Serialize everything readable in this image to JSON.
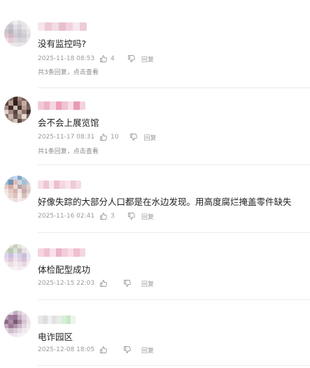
{
  "comments": [
    {
      "text": "没有监控吗?",
      "date": "2025-11-18 08:53",
      "likes": "4",
      "reply_label": "回复",
      "replies_text": "共3条回复，点击查看",
      "avatar_colors": [
        "#e9e7ec",
        "#dcd8de",
        "#f1eef1",
        "#e4e0e6",
        "#e9e6ea",
        "#f3f1f4",
        "#d3d0d7",
        "#c7c2cc",
        "#e2dfe4",
        "#d7d3da",
        "#e7e4e9",
        "#f0edf0",
        "#c9c5ce",
        "#bbb5c1",
        "#d7d3da",
        "#cbc7d0",
        "#d8d4db",
        "#e9e6ea",
        "#e0c4cf",
        "#d5b6c2",
        "#cfcad4",
        "#c7c2cc",
        "#d0ccd5",
        "#e2dfe4",
        "#f0dde4",
        "#e8c8d4",
        "#dcd8de",
        "#d6d2d9",
        "#d9d5dc",
        "#eceaee",
        "#f4eef1",
        "#efe3e8",
        "#ebe8ec",
        "#e8e5ea",
        "#ebe8ec",
        "#f2f0f3"
      ],
      "name_colors": [
        "#f4e6ec",
        "#eccad7",
        "#f2dde5",
        "#e8bfcf",
        "#f0d3de",
        "#f6e8ee",
        "#eecbd8"
      ]
    },
    {
      "text": "会不会上展览馆",
      "date": "2025-11-17 08:31",
      "likes": "10",
      "reply_label": "回复",
      "replies_text": "共1条回复，点击查看",
      "avatar_colors": [
        "#6d5a57",
        "#8c6f66",
        "#3d2b2a",
        "#a48478",
        "#7a5f57",
        "#9b857a",
        "#5c4641",
        "#b79b8b",
        "#2c1e1e",
        "#8e6b60",
        "#c7ae9f",
        "#6c5450",
        "#a78d81",
        "#3e2c2a",
        "#d2bcb0",
        "#4a3633",
        "#b89b8e",
        "#7d625b",
        "#e0cfc6",
        "#a3887c",
        "#5a4541",
        "#c4aea2",
        "#8c7268",
        "#3c2c2a",
        "#917469",
        "#cdb6aa",
        "#6b534d",
        "#a28a7e",
        "#e6d8d0",
        "#7b6058",
        "#4f3c39",
        "#b19a8f",
        "#d5c3ba",
        "#5f4843",
        "#9f857a",
        "#c9b4a9"
      ],
      "name_colors": [
        "#f2c9d8",
        "#eab4c8",
        "#f6d7e2",
        "#ee9fbb",
        "#f0c2d2",
        "#f7dfe8",
        "#e99ab7",
        "#f3d2de"
      ]
    },
    {
      "text": "好像失踪的大部分人口都是在水边发现。用高度腐烂掩盖零件缺失",
      "date": "2025-11-16 02:41",
      "likes": "3",
      "reply_label": "回复",
      "replies_text": "",
      "avatar_colors": [
        "#8fb6d6",
        "#a7c7e1",
        "#c6d9ea",
        "#7ea7cb",
        "#b6cfe4",
        "#d7e5f0",
        "#9ab9d5",
        "#6f93b6",
        "#e2b9b3",
        "#cfd6de",
        "#a4bfd9",
        "#c0cbd6",
        "#e4ccc7",
        "#d9a7a0",
        "#f0dad6",
        "#b7a4a8",
        "#cfb7b6",
        "#e6d4d1",
        "#f1e4e2",
        "#e9c7c1",
        "#d4b2ae",
        "#efe1df",
        "#c9a9a8",
        "#dfcac8",
        "#f3ebea",
        "#ead5d2",
        "#e2c0ba",
        "#f6efee",
        "#d8bdb9",
        "#efe3e1",
        "#f7f1f0",
        "#f2e6e4",
        "#eddbd8",
        "#f4ecea",
        "#f0e2df",
        "#f8f3f2"
      ],
      "name_colors": [
        "#f6dfe7",
        "#f0c6d5",
        "#f9e8ee",
        "#ecc0cf",
        "#f4d6e0",
        "#f8e4eb",
        "#efcad7",
        "#f5dbe4"
      ]
    },
    {
      "text": "体检配型成功",
      "date": "2025-12-15 22:03",
      "likes": "",
      "reply_label": "回复",
      "replies_text": "",
      "avatar_colors": [
        "#e8ebe6",
        "#d4dccf",
        "#c6d3bf",
        "#dfe5dc",
        "#edf0ec",
        "#f2f4f1",
        "#cfd8ca",
        "#b9c8b2",
        "#d9e0d5",
        "#c9c0c4",
        "#e6e0e2",
        "#eef0ed",
        "#dcd4ee",
        "#c9bde3",
        "#e6dff2",
        "#d7d0e8",
        "#c8bfdc",
        "#ebe7f3",
        "#e9d9e6",
        "#dcc4d9",
        "#efe2ec",
        "#e2d1e4",
        "#d5c1d7",
        "#f1e8f0",
        "#f6edf2",
        "#eedde8",
        "#f5ecf1",
        "#f1e3ec",
        "#e9d6e3",
        "#f7f0f4",
        "#f9f5f7",
        "#f6eef2",
        "#f8f2f5",
        "#f5ebf0",
        "#f7f0f3",
        "#faf7f9"
      ],
      "name_colors": [
        "#f5d3df",
        "#efbfd1",
        "#f8e1ea",
        "#eab4c9",
        "#f3ccd9",
        "#f7dce6",
        "#eebfd0",
        "#f4d5e1"
      ]
    },
    {
      "text": "电诈园区",
      "date": "2025-12-08 18:05",
      "likes": "",
      "reply_label": "回复",
      "replies_text": "",
      "avatar_colors": [
        "#d7c7d6",
        "#e5d8e3",
        "#c1a9c0",
        "#dccbd9",
        "#ece2ea",
        "#f3edf2",
        "#b99db6",
        "#a47c9f",
        "#9a7395",
        "#c7adc3",
        "#e0d0dd",
        "#efe6ed",
        "#8f6a8b",
        "#b08bab",
        "#7d5a79",
        "#a886a3",
        "#d7c4d3",
        "#ede3eb",
        "#c2a7bd",
        "#9d7898",
        "#b591af",
        "#cdb4c8",
        "#e4d6e1",
        "#f2ebf0",
        "#e6d9e2",
        "#d1bccc",
        "#dccad8",
        "#e9dde6",
        "#f1e9ef",
        "#f6f1f5",
        "#f3ecf1",
        "#ece1ea",
        "#f0e7ee",
        "#f5eff3",
        "#f8f4f7",
        "#faf8fa"
      ],
      "name_colors": [
        "#e9e9e9",
        "#dedede",
        "#f0f0f0",
        "#e3e3e3",
        "#eaeaea",
        "#d8efd8",
        "#c6e8c6",
        "#ecf6ec"
      ]
    }
  ]
}
